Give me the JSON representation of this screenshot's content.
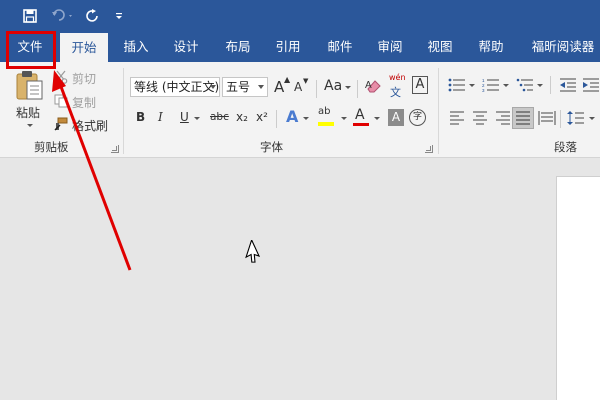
{
  "quick_access": {
    "save_icon": "save-icon",
    "undo_icon": "undo-icon",
    "redo_icon": "redo-icon",
    "customize_icon": "customize-quick-access-icon"
  },
  "tabs": [
    {
      "label": "文件"
    },
    {
      "label": "开始",
      "active": true
    },
    {
      "label": "插入"
    },
    {
      "label": "设计"
    },
    {
      "label": "布局"
    },
    {
      "label": "引用"
    },
    {
      "label": "邮件"
    },
    {
      "label": "审阅"
    },
    {
      "label": "视图"
    },
    {
      "label": "帮助"
    },
    {
      "label": "福昕阅读器"
    }
  ],
  "clipboard": {
    "paste_label": "粘贴",
    "cut_label": "剪切",
    "copy_label": "复制",
    "format_painter_label": "格式刷",
    "group_label": "剪贴板"
  },
  "font": {
    "font_name": "等线 (中文正文)",
    "font_size": "五号",
    "bold": "B",
    "italic": "I",
    "underline": "U",
    "strikethrough": "abc",
    "subscript": "x₂",
    "superscript": "x²",
    "grow": "A",
    "shrink": "A",
    "change_case": "Aa",
    "phonetic_top": "wén",
    "phonetic_bottom": "文",
    "border": "A",
    "text_effect": "A",
    "highlight": "ab",
    "font_color": "A",
    "shading": "A",
    "enclose": "字",
    "group_label": "字体"
  },
  "paragraph": {
    "group_label": "段落"
  },
  "colors": {
    "title_blue": "#2b579a",
    "ribbon_bg": "#f3f3f3",
    "highlight_yellow": "#ffff00",
    "font_red": "#e00000",
    "annotation_red": "#e00000"
  }
}
